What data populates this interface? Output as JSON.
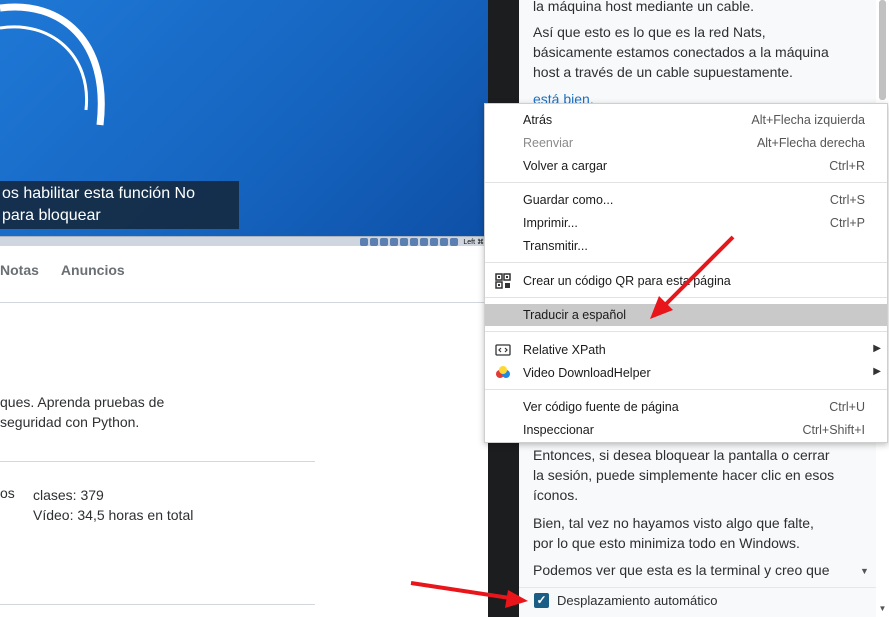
{
  "video": {
    "caption_line1": "os habilitar esta función No",
    "caption_line2": "para bloquear",
    "vm_statusbar_key": "Left ⌘"
  },
  "course_tabs": [
    {
      "label": "Notas"
    },
    {
      "label": "Anuncios"
    }
  ],
  "description": {
    "line1": "ques. Aprenda pruebas de",
    "line2": "seguridad con Python."
  },
  "stats": {
    "left_label": "os",
    "classes": "clases: 379",
    "video": "Vídeo: 34,5 horas en total"
  },
  "transcript": {
    "lines_top": [
      "la máquina host mediante un cable."
    ],
    "para1": [
      "Así que esto es lo que es la red Nats,",
      "básicamente estamos conectados a la máquina",
      "host a través de un cable supuestamente."
    ],
    "active": "está bien.",
    "para2": [
      "Entonces, si desea bloquear la pantalla o cerrar",
      "la sesión, puede simplemente hacer clic en esos",
      "íconos."
    ],
    "para3": [
      "Bien, tal vez no hayamos visto algo que falte,",
      "por lo que esto minimiza todo en Windows."
    ],
    "para4": "Podemos ver que esta es la terminal y creo que",
    "autoscroll_label": "Desplazamiento automático"
  },
  "context_menu": {
    "items": [
      {
        "label": "Atrás",
        "shortcut": "Alt+Flecha izquierda",
        "enabled": true
      },
      {
        "label": "Reenviar",
        "shortcut": "Alt+Flecha derecha",
        "enabled": false
      },
      {
        "label": "Volver a cargar",
        "shortcut": "Ctrl+R",
        "enabled": true
      },
      {
        "label": "Guardar como...",
        "shortcut": "Ctrl+S",
        "enabled": true
      },
      {
        "label": "Imprimir...",
        "shortcut": "Ctrl+P",
        "enabled": true
      },
      {
        "label": "Transmitir...",
        "shortcut": "",
        "enabled": true
      },
      {
        "label": "Crear un código QR para esta página",
        "shortcut": "",
        "icon": "qr-code-icon",
        "enabled": true
      },
      {
        "label": "Traducir a español",
        "shortcut": "",
        "highlighted": true,
        "enabled": true
      },
      {
        "label": "Relative XPath",
        "shortcut": "",
        "icon": "xpath-extension-icon",
        "submenu": true,
        "enabled": true
      },
      {
        "label": "Video DownloadHelper",
        "shortcut": "",
        "icon": "video-downloadhelper-icon",
        "submenu": true,
        "enabled": true
      },
      {
        "label": "Ver código fuente de página",
        "shortcut": "Ctrl+U",
        "enabled": true
      },
      {
        "label": "Inspeccionar",
        "shortcut": "Ctrl+Shift+I",
        "enabled": true
      }
    ]
  },
  "colors": {
    "annotation_arrow": "#e8161b",
    "highlight_row": "#c9c9c9",
    "active_transcript": "#1f6fbf",
    "checkbox": "#1b5e85"
  }
}
